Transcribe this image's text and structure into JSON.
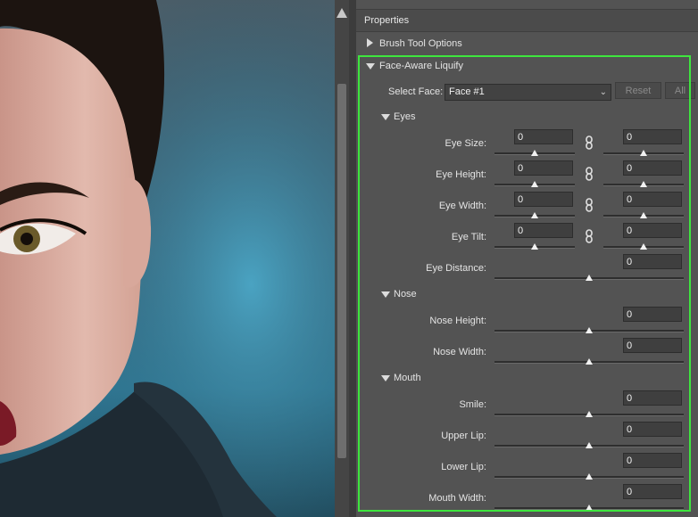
{
  "panel": {
    "title": "Properties",
    "brush_tool_options": "Brush Tool Options",
    "face_aware_liquify": "Face-Aware Liquify"
  },
  "select_face": {
    "label": "Select Face:",
    "value": "Face #1",
    "reset_label": "Reset",
    "all_label": "All"
  },
  "sections": {
    "eyes": "Eyes",
    "nose": "Nose",
    "mouth": "Mouth"
  },
  "eyes": {
    "eye_size": {
      "label": "Eye Size:",
      "left": "0",
      "right": "0",
      "left_level": 0.5,
      "right_level": 0.5
    },
    "eye_height": {
      "label": "Eye Height:",
      "left": "0",
      "right": "0",
      "left_level": 0.5,
      "right_level": 0.5
    },
    "eye_width": {
      "label": "Eye Width:",
      "left": "0",
      "right": "0",
      "left_level": 0.5,
      "right_level": 0.5
    },
    "eye_tilt": {
      "label": "Eye Tilt:",
      "left": "0",
      "right": "0",
      "left_level": 0.5,
      "right_level": 0.5
    },
    "eye_distance": {
      "label": "Eye Distance:",
      "value": "0",
      "level": 0.5
    }
  },
  "nose": {
    "nose_height": {
      "label": "Nose Height:",
      "value": "0",
      "level": 0.5
    },
    "nose_width": {
      "label": "Nose Width:",
      "value": "0",
      "level": 0.5
    }
  },
  "mouth": {
    "smile": {
      "label": "Smile:",
      "value": "0",
      "level": 0.5
    },
    "upper_lip": {
      "label": "Upper Lip:",
      "value": "0",
      "level": 0.5
    },
    "lower_lip": {
      "label": "Lower Lip:",
      "value": "0",
      "level": 0.5
    },
    "mouth_width": {
      "label": "Mouth Width:",
      "value": "0",
      "level": 0.5
    }
  },
  "colors": {
    "highlight": "#3ee63e",
    "panel_bg": "#535353"
  }
}
